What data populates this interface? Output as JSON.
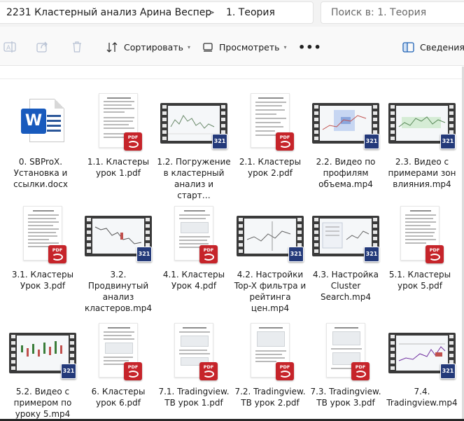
{
  "address_bar": {
    "crumbs": [
      "2231 Кластерный анализ Арина Веспер",
      "1. Теория"
    ],
    "separator": ">",
    "search_placeholder": "Поиск в: 1. Теория"
  },
  "toolbar": {
    "sort_label": "Сортировать",
    "view_label": "Просмотреть",
    "more_label": "•••",
    "details_label": "Сведения"
  },
  "files": [
    {
      "name": "0. SBProX. Установка и ссылки.docx",
      "type": "docx"
    },
    {
      "name": "1.1. Кластеры урок 1.pdf",
      "type": "pdf"
    },
    {
      "name": "1.2. Погружение в кластерный анализ и старт…",
      "type": "mp4"
    },
    {
      "name": "2.1. Кластеры урок 2.pdf",
      "type": "pdf"
    },
    {
      "name": "2.2. Видео по профилям объема.mp4",
      "type": "mp4"
    },
    {
      "name": "2.3. Видео с примерами зон влияния.mp4",
      "type": "mp4"
    },
    {
      "name": "3.1. Кластеры Урок 3.pdf",
      "type": "pdf"
    },
    {
      "name": "3.2. Продвинутый анализ кластеров.mp4",
      "type": "mp4"
    },
    {
      "name": "4.1. Кластеры Урок 4.pdf",
      "type": "pdf"
    },
    {
      "name": "4.2. Настройки Top-X фильтра и рейтинга цен.mp4",
      "type": "mp4"
    },
    {
      "name": "4.3. Настройка Cluster Search.mp4",
      "type": "mp4"
    },
    {
      "name": "5.1. Кластеры урок 5.pdf",
      "type": "pdf"
    },
    {
      "name": "5.2. Видео с примером по уроку 5.mp4",
      "type": "mp4"
    },
    {
      "name": "6. Кластеры урок 6.pdf",
      "type": "pdf"
    },
    {
      "name": "7.1. Tradingview. ТВ урок 1.pdf",
      "type": "pdf"
    },
    {
      "name": "7.2. Tradingview. ТВ урок 2.pdf",
      "type": "pdf"
    },
    {
      "name": "7.3. Tradingview. ТВ урок 3.pdf",
      "type": "pdf"
    },
    {
      "name": "7.4. Tradingview.mp4",
      "type": "mp4"
    }
  ],
  "badges": {
    "pdf_text": "PDF",
    "video_text": "321",
    "word_letter": "W"
  },
  "colors": {
    "accent": "#185abd",
    "pdf": "#c6242a",
    "video_badge": "#243a7a"
  }
}
